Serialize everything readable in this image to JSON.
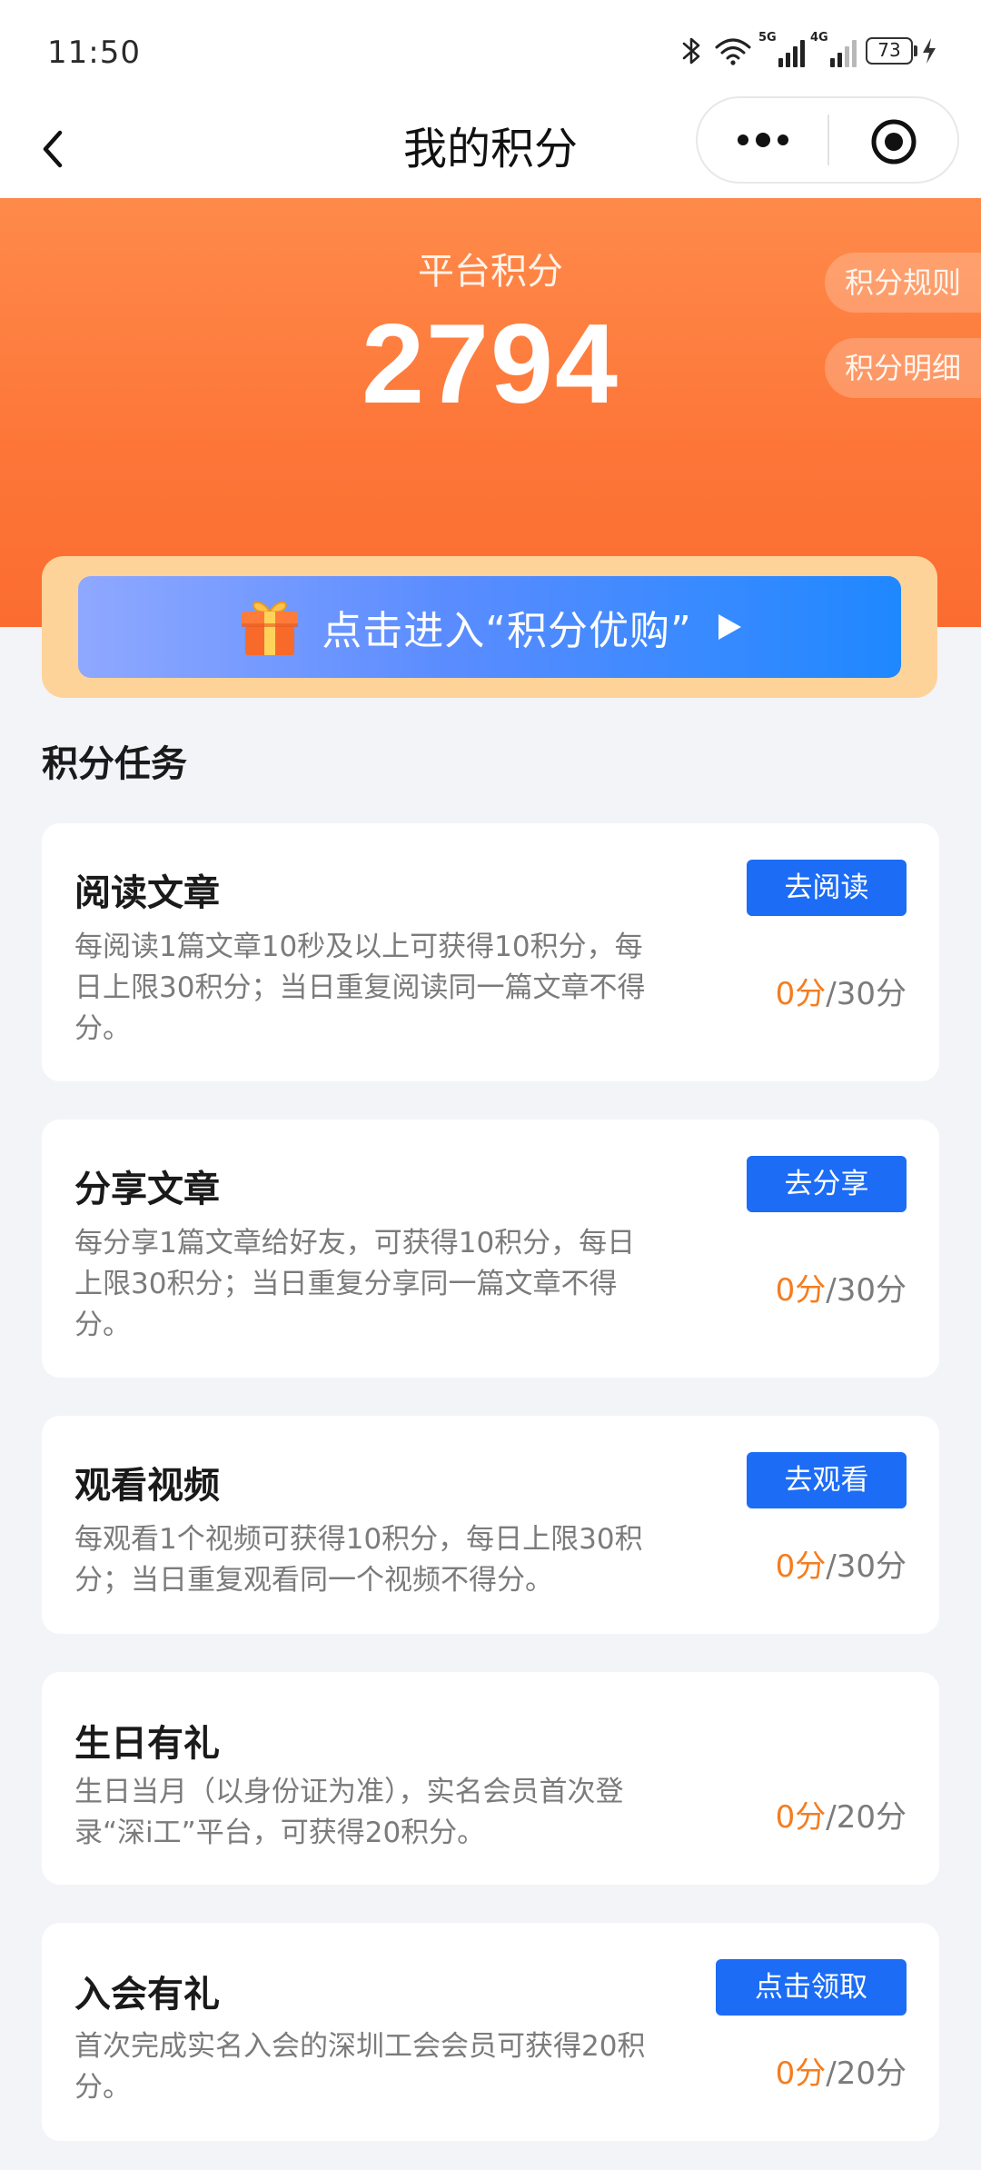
{
  "status_bar": {
    "time": "11:50",
    "signal_1": "5G",
    "signal_2": "4G",
    "battery": "73"
  },
  "nav": {
    "title": "我的积分"
  },
  "points": {
    "label": "平台积分",
    "value": "2794",
    "rules_label": "积分规则",
    "detail_label": "积分明细"
  },
  "promo": {
    "text": "点击进入“积分优购”"
  },
  "tasks_section": {
    "title": "积分任务",
    "items": [
      {
        "title": "阅读文章",
        "description": "每阅读1篇文章10秒及以上可获得10积分，每日上限30积分；当日重复阅读同一篇文章不得分。",
        "button": "去阅读",
        "earned": "0分",
        "limit": "/30分"
      },
      {
        "title": "分享文章",
        "description": "每分享1篇文章给好友，可获得10积分，每日上限30积分；当日重复分享同一篇文章不得分。",
        "button": "去分享",
        "earned": "0分",
        "limit": "/30分"
      },
      {
        "title": "观看视频",
        "description": "每观看1个视频可获得10积分，每日上限30积分；当日重复观看同一个视频不得分。",
        "button": "去观看",
        "earned": "0分",
        "limit": "/30分"
      },
      {
        "title": "生日有礼",
        "description": "生日当月（以身份证为准），实名会员首次登录“深i工”平台，可获得20积分。",
        "earned": "0分",
        "limit": "/20分"
      },
      {
        "title": "入会有礼",
        "description": "首次完成实名入会的深圳工会会员可获得20积分。",
        "button": "点击领取",
        "earned": "0分",
        "limit": "/20分"
      }
    ]
  },
  "colors": {
    "brand_orange": "#fd7739",
    "button_blue": "#1c6cf5",
    "score_orange": "#f57d1f",
    "promo_gold": "#fed39a"
  },
  "icons": [
    "bluetooth-icon",
    "wifi-icon",
    "signal-icon",
    "battery-icon",
    "charging-icon",
    "back-icon",
    "more-icon",
    "close-miniprogram-icon",
    "gift-icon",
    "play-icon"
  ]
}
